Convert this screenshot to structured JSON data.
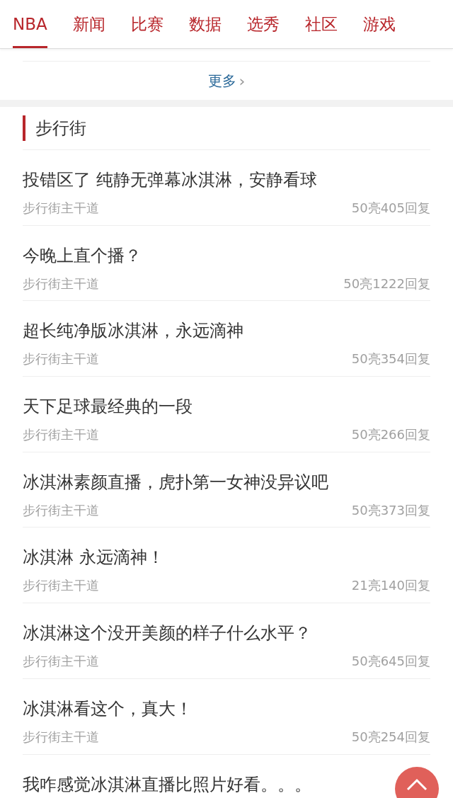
{
  "nav": {
    "tabs": [
      {
        "label": "NBA",
        "selected": true
      },
      {
        "label": "新闻",
        "selected": false
      },
      {
        "label": "比赛",
        "selected": false
      },
      {
        "label": "数据",
        "selected": false
      },
      {
        "label": "选秀",
        "selected": false
      },
      {
        "label": "社区",
        "selected": false
      },
      {
        "label": "游戏",
        "selected": false
      }
    ]
  },
  "more_link": {
    "label": "更多",
    "arrow": "›"
  },
  "section": {
    "title": "步行街",
    "posts": [
      {
        "title": "投错区了 纯静无弹幕冰淇淋，安静看球",
        "board": "步行街主干道",
        "stats": "50亮405回复"
      },
      {
        "title": "今晚上直个播？",
        "board": "步行街主干道",
        "stats": "50亮1222回复"
      },
      {
        "title": "超长纯净版冰淇淋，永远滴神",
        "board": "步行街主干道",
        "stats": "50亮354回复"
      },
      {
        "title": "天下足球最经典的一段",
        "board": "步行街主干道",
        "stats": "50亮266回复"
      },
      {
        "title": "冰淇淋素颜直播，虎扑第一女神没异议吧",
        "board": "步行街主干道",
        "stats": "50亮373回复"
      },
      {
        "title": "冰淇淋 永远滴神！",
        "board": "步行街主干道",
        "stats": "21亮140回复"
      },
      {
        "title": "冰淇淋这个没开美颜的样子什么水平？",
        "board": "步行街主干道",
        "stats": "50亮645回复"
      },
      {
        "title": "冰淇淋看这个，真大！",
        "board": "步行街主干道",
        "stats": "50亮254回复"
      },
      {
        "title": "我咋感觉冰淇淋直播比照片好看。。。"
      }
    ]
  }
}
